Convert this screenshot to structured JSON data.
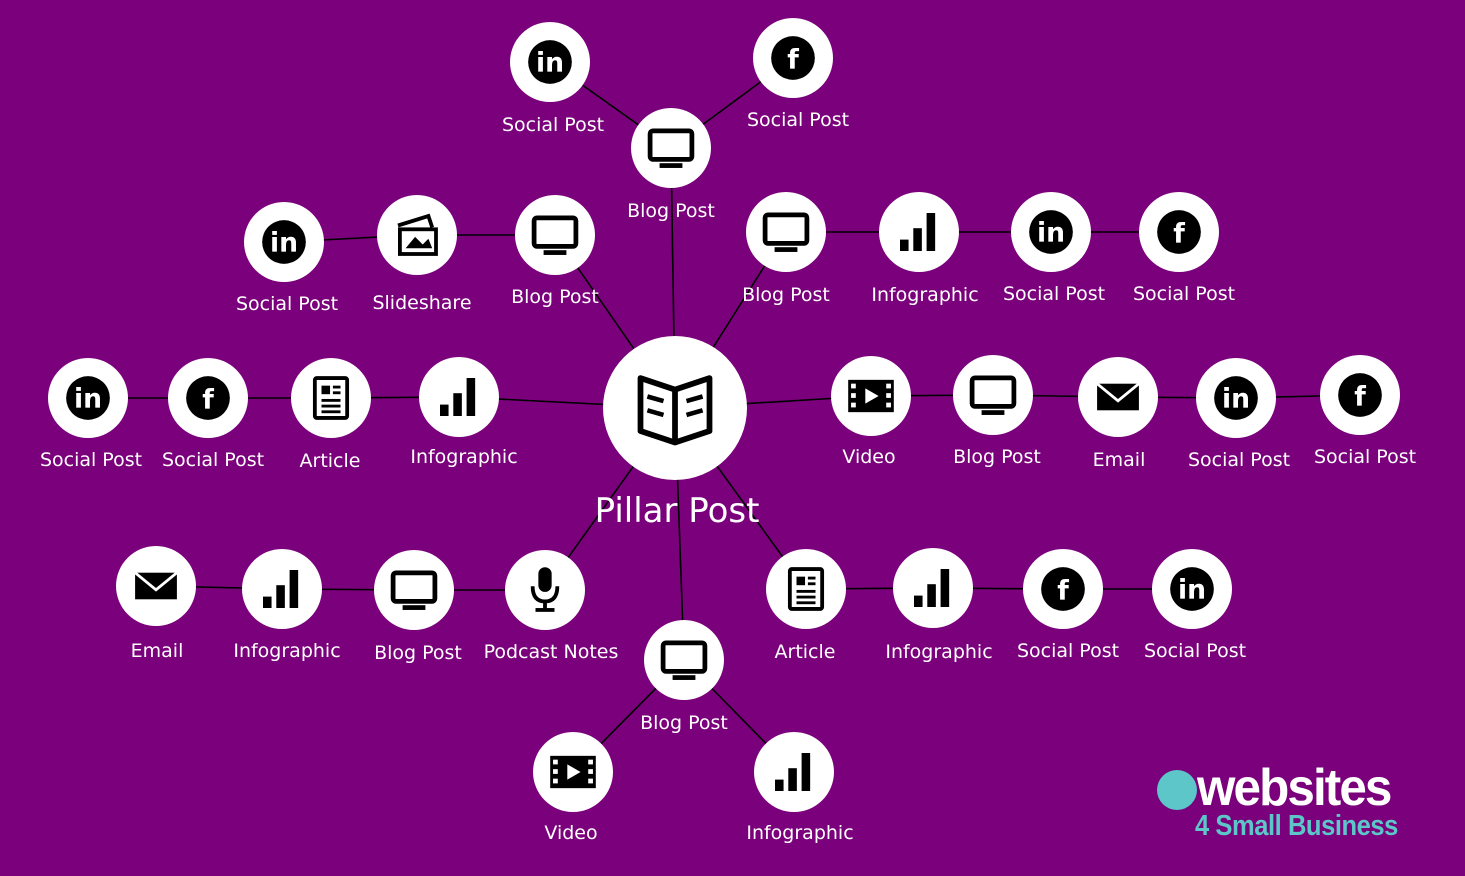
{
  "colors": {
    "background": "#7b007b",
    "node": "#ffffff",
    "icon": "#000000",
    "label": "#ffffff",
    "logo_accent": "#5cc6c8"
  },
  "nodes": [
    {
      "id": "pillar",
      "icon": "open-book-icon",
      "label": "Pillar Post"
    },
    {
      "id": "blog-top",
      "icon": "monitor-icon",
      "label": "Blog Post"
    },
    {
      "id": "li-top",
      "icon": "linkedin-icon",
      "label": "Social Post"
    },
    {
      "id": "fb-top",
      "icon": "facebook-icon",
      "label": "Social Post"
    },
    {
      "id": "blog-ul",
      "icon": "monitor-icon",
      "label": "Blog Post"
    },
    {
      "id": "slide-ul",
      "icon": "slideshare-icon",
      "label": "Slideshare"
    },
    {
      "id": "li-ul",
      "icon": "linkedin-icon",
      "label": "Social Post"
    },
    {
      "id": "blog-ur",
      "icon": "monitor-icon",
      "label": "Blog Post"
    },
    {
      "id": "info-ur",
      "icon": "bar-chart-icon",
      "label": "Infographic"
    },
    {
      "id": "li-ur",
      "icon": "linkedin-icon",
      "label": "Social Post"
    },
    {
      "id": "fb-ur",
      "icon": "facebook-icon",
      "label": "Social Post"
    },
    {
      "id": "info-l",
      "icon": "bar-chart-icon",
      "label": "Infographic"
    },
    {
      "id": "article-l",
      "icon": "article-icon",
      "label": "Article"
    },
    {
      "id": "fb-l",
      "icon": "facebook-icon",
      "label": "Social Post"
    },
    {
      "id": "li-l",
      "icon": "linkedin-icon",
      "label": "Social Post"
    },
    {
      "id": "video-r",
      "icon": "video-icon",
      "label": "Video"
    },
    {
      "id": "blog-r",
      "icon": "monitor-icon",
      "label": "Blog Post"
    },
    {
      "id": "email-r",
      "icon": "email-icon",
      "label": "Email"
    },
    {
      "id": "li-r",
      "icon": "linkedin-icon",
      "label": "Social Post"
    },
    {
      "id": "fb-r",
      "icon": "facebook-icon",
      "label": "Social Post"
    },
    {
      "id": "podcast-ll",
      "icon": "microphone-icon",
      "label": "Podcast Notes"
    },
    {
      "id": "blog-ll",
      "icon": "monitor-icon",
      "label": "Blog Post"
    },
    {
      "id": "info-ll",
      "icon": "bar-chart-icon",
      "label": "Infographic"
    },
    {
      "id": "email-ll",
      "icon": "email-icon",
      "label": "Email"
    },
    {
      "id": "article-lr",
      "icon": "article-icon",
      "label": "Article"
    },
    {
      "id": "info-lr",
      "icon": "bar-chart-icon",
      "label": "Infographic"
    },
    {
      "id": "fb-lr",
      "icon": "facebook-icon",
      "label": "Social Post"
    },
    {
      "id": "li-lr",
      "icon": "linkedin-icon",
      "label": "Social Post"
    },
    {
      "id": "blog-b",
      "icon": "monitor-icon",
      "label": "Blog Post"
    },
    {
      "id": "video-b",
      "icon": "video-icon",
      "label": "Video"
    },
    {
      "id": "info-b",
      "icon": "bar-chart-icon",
      "label": "Infographic"
    }
  ],
  "edges": [
    [
      "pillar",
      "blog-top"
    ],
    [
      "blog-top",
      "li-top"
    ],
    [
      "blog-top",
      "fb-top"
    ],
    [
      "pillar",
      "blog-ul"
    ],
    [
      "blog-ul",
      "slide-ul"
    ],
    [
      "slide-ul",
      "li-ul"
    ],
    [
      "pillar",
      "blog-ur"
    ],
    [
      "blog-ur",
      "info-ur"
    ],
    [
      "info-ur",
      "li-ur"
    ],
    [
      "li-ur",
      "fb-ur"
    ],
    [
      "pillar",
      "info-l"
    ],
    [
      "info-l",
      "article-l"
    ],
    [
      "article-l",
      "fb-l"
    ],
    [
      "fb-l",
      "li-l"
    ],
    [
      "pillar",
      "video-r"
    ],
    [
      "video-r",
      "blog-r"
    ],
    [
      "blog-r",
      "email-r"
    ],
    [
      "email-r",
      "li-r"
    ],
    [
      "li-r",
      "fb-r"
    ],
    [
      "pillar",
      "podcast-ll"
    ],
    [
      "podcast-ll",
      "blog-ll"
    ],
    [
      "blog-ll",
      "info-ll"
    ],
    [
      "info-ll",
      "email-ll"
    ],
    [
      "pillar",
      "article-lr"
    ],
    [
      "article-lr",
      "info-lr"
    ],
    [
      "info-lr",
      "fb-lr"
    ],
    [
      "fb-lr",
      "li-lr"
    ],
    [
      "pillar",
      "blog-b"
    ],
    [
      "blog-b",
      "video-b"
    ],
    [
      "blog-b",
      "info-b"
    ]
  ],
  "logo": {
    "line1": "websites",
    "line2": "4 Small Business"
  }
}
